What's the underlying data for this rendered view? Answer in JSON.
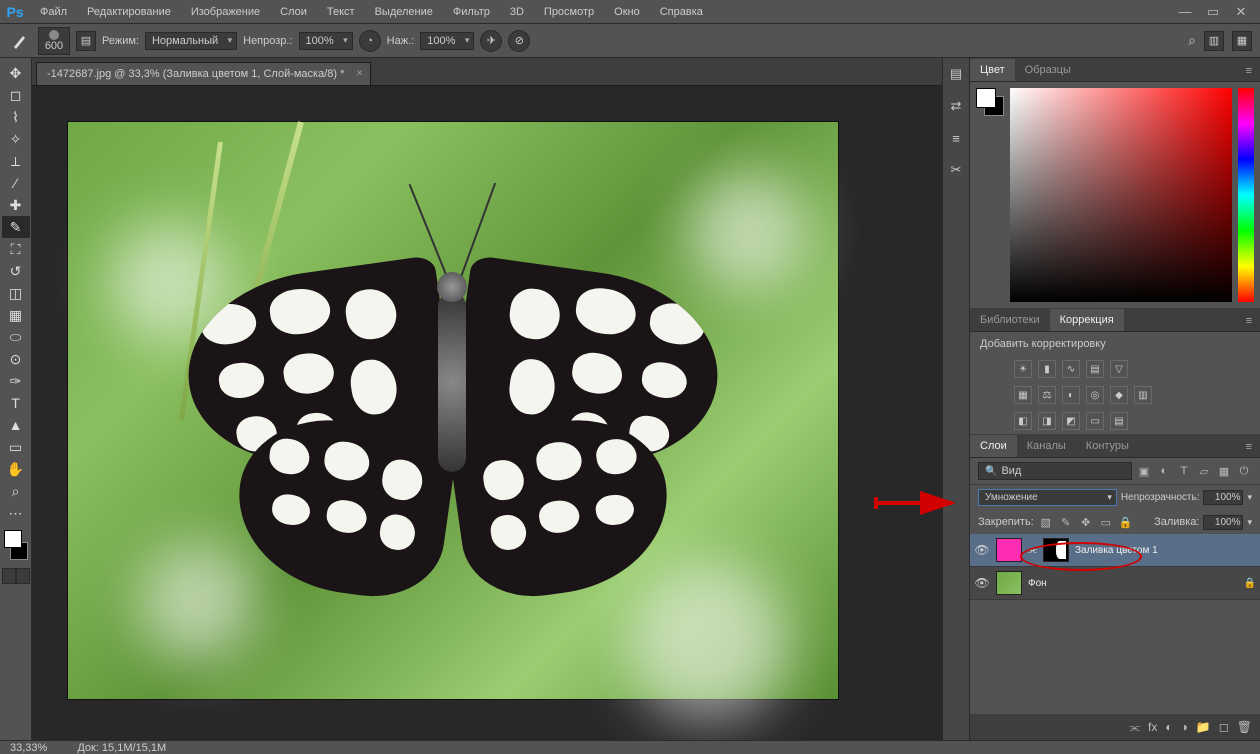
{
  "menu": {
    "items": [
      "Файл",
      "Редактирование",
      "Изображение",
      "Слои",
      "Текст",
      "Выделение",
      "Фильтр",
      "3D",
      "Просмотр",
      "Окно",
      "Справка"
    ]
  },
  "options": {
    "brush_size": "600",
    "mode_label": "Режим:",
    "mode_value": "Нормальный",
    "opacity_label": "Непрозр.:",
    "opacity_value": "100%",
    "flow_label": "Наж.:",
    "flow_value": "100%"
  },
  "document": {
    "tab_title": "-1472687.jpg @ 33,3% (Заливка цветом 1, Слой-маска/8) *"
  },
  "panels": {
    "color_tab": "Цвет",
    "swatches_tab": "Образцы",
    "lib_tab": "Библиотеки",
    "corr_tab": "Коррекция",
    "adj_label": "Добавить корректировку",
    "layers_tab": "Слои",
    "channels_tab": "Каналы",
    "paths_tab": "Контуры",
    "kind_label": "Вид",
    "blend_mode": "Умножение",
    "opacity_label": "Непрозрачность:",
    "opacity_value": "100%",
    "lock_label": "Закрепить:",
    "fill_label": "Заливка:",
    "fill_value": "100%",
    "layer1_name": "Заливка цветом 1",
    "layer2_name": "Фон"
  },
  "status": {
    "zoom": "33,33%",
    "doc": "Док: 15,1M/15,1M"
  }
}
